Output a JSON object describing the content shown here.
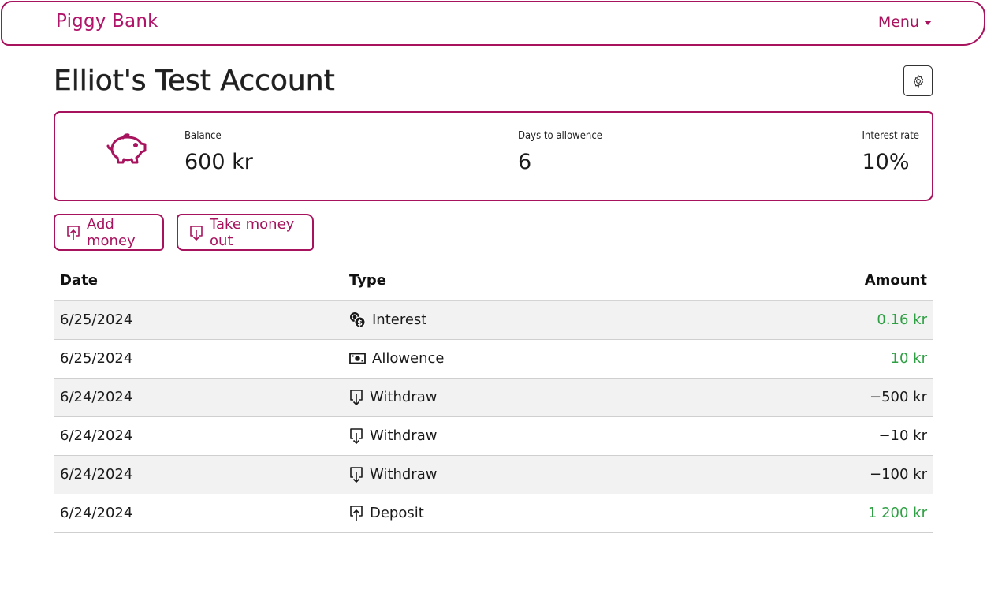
{
  "navbar": {
    "brand": "Piggy Bank",
    "menu_label": "Menu"
  },
  "page": {
    "title": "Elliot's Test Account"
  },
  "summary": {
    "balance_label": "Balance",
    "balance_value": "600 kr",
    "days_label": "Days to allowence",
    "days_value": "6",
    "rate_label": "Interest rate",
    "rate_value": "10%"
  },
  "actions": {
    "add_label": "Add money",
    "take_label": "Take money out"
  },
  "table": {
    "headers": {
      "date": "Date",
      "type": "Type",
      "amount": "Amount"
    },
    "rows": [
      {
        "date": "6/25/2024",
        "type": "Interest",
        "icon": "coins-icon",
        "amount": "0.16 kr",
        "positive": true
      },
      {
        "date": "6/25/2024",
        "type": "Allowence",
        "icon": "cash-icon",
        "amount": "10 kr",
        "positive": true
      },
      {
        "date": "6/24/2024",
        "type": "Withdraw",
        "icon": "withdraw-icon",
        "amount": "−500 kr",
        "positive": false
      },
      {
        "date": "6/24/2024",
        "type": "Withdraw",
        "icon": "withdraw-icon",
        "amount": "−10 kr",
        "positive": false
      },
      {
        "date": "6/24/2024",
        "type": "Withdraw",
        "icon": "withdraw-icon",
        "amount": "−100 kr",
        "positive": false
      },
      {
        "date": "6/24/2024",
        "type": "Deposit",
        "icon": "deposit-icon",
        "amount": "1 200 kr",
        "positive": true
      }
    ]
  },
  "colors": {
    "accent": "#a8135e",
    "positive": "#2ea043",
    "stripe": "#f2f2f2"
  }
}
